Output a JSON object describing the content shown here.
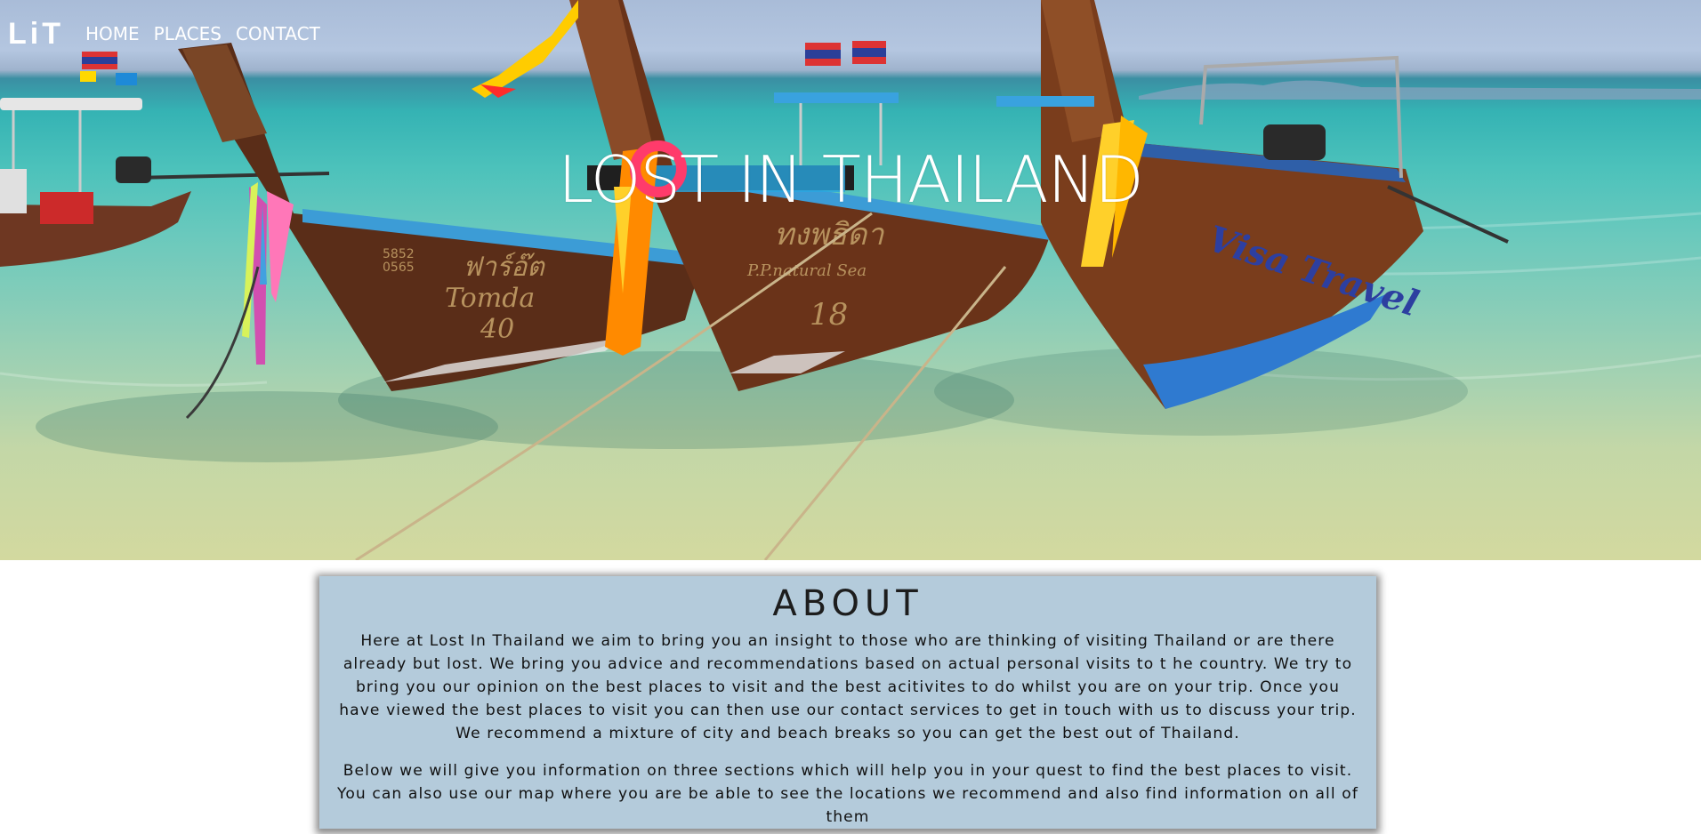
{
  "nav": {
    "logo": "LiT",
    "links": [
      "HOME",
      "PLACES",
      "CONTACT"
    ]
  },
  "hero": {
    "title": "LOST IN THAILAND",
    "image_description": "three wooden longtail boats with garlands moored in turquoise water",
    "boat_paint": [
      "5852 0565",
      "ฟาร์อ๊ต",
      "Tomda",
      "40",
      "P.P.natural Sea",
      "18",
      "Visa Travel"
    ]
  },
  "about": {
    "title": "ABOUT",
    "paragraphs": [
      "Here at Lost In Thailand we aim to bring you an insight to those who are thinking of visiting Thailand or are there already but lost. We bring you advice and recommendations based on actual personal visits to t he country. We try to bring you our opinion on the best places to visit and the best acitivites to do whilst you are on your trip. Once you have viewed the best places to visit you can then use our contact services to get in touch with us to discuss your trip. We recommend a mixture of city and beach breaks so you can get the best out of Thailand.",
      "Below we will give you information on three sections which will help you in your quest to find the best places to visit. You can also use our map where you are be able to see the locations we recommend and also find information on all of them"
    ]
  },
  "colors": {
    "about_bg": "#b4cbdb",
    "nav_text": "#ffffff",
    "sea": "#35b3b4",
    "sky": "#a9bcd8"
  }
}
